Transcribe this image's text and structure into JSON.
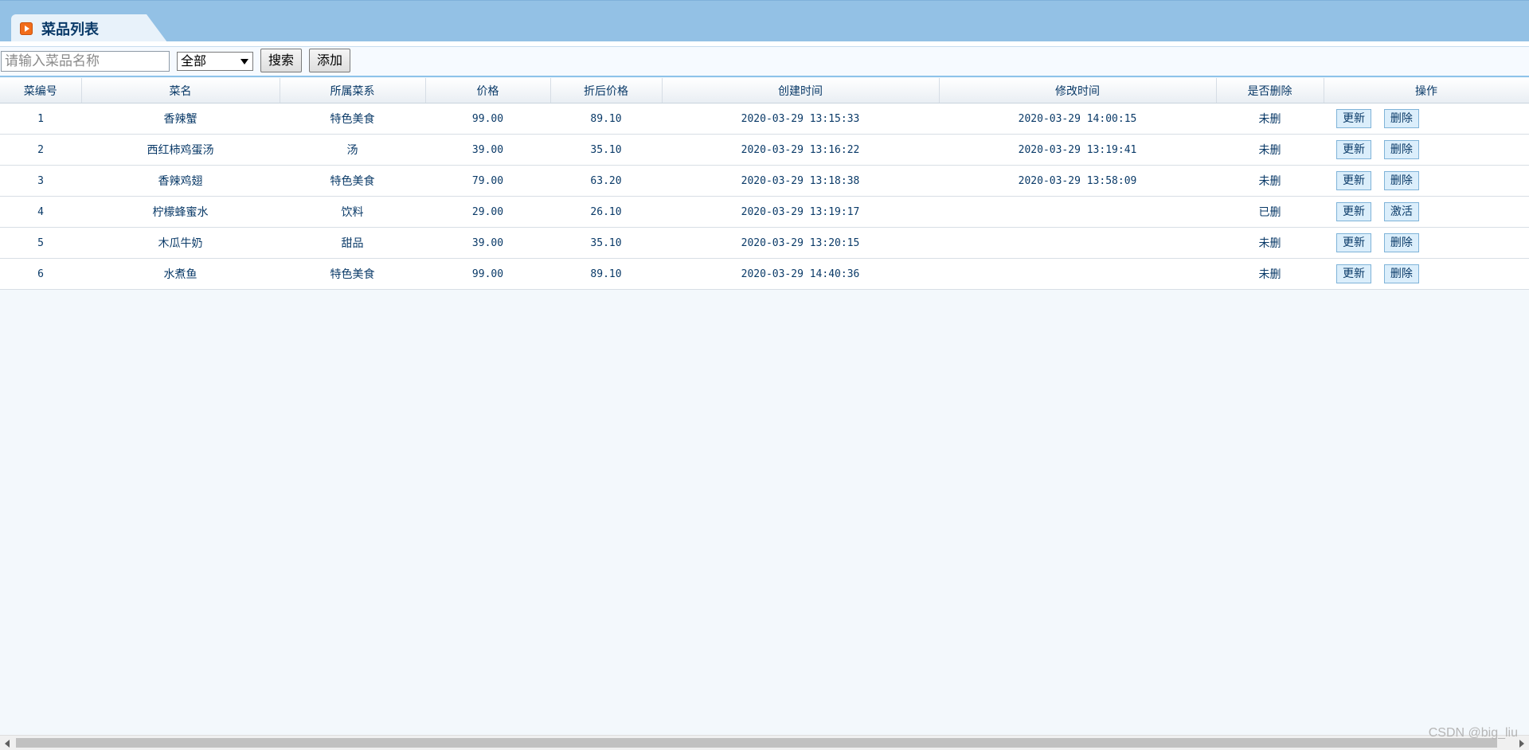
{
  "header": {
    "title": "菜品列表",
    "icon": "play-icon"
  },
  "toolbar": {
    "search_placeholder": "请输入菜品名称",
    "search_value": "",
    "category_selected": "全部",
    "search_label": "搜索",
    "add_label": "添加"
  },
  "table": {
    "columns": [
      "菜编号",
      "菜名",
      "所属菜系",
      "价格",
      "折后价格",
      "创建时间",
      "修改时间",
      "是否删除",
      "操作"
    ],
    "rows": [
      {
        "id": "1",
        "name": "香辣蟹",
        "category": "特色美食",
        "price": "99.00",
        "discount": "89.10",
        "created": "2020-03-29 13:15:33",
        "modified": "2020-03-29 14:00:15",
        "deleted": "未删",
        "update_label": "更新",
        "action_label": "删除"
      },
      {
        "id": "2",
        "name": "西红柿鸡蛋汤",
        "category": "汤",
        "price": "39.00",
        "discount": "35.10",
        "created": "2020-03-29 13:16:22",
        "modified": "2020-03-29 13:19:41",
        "deleted": "未删",
        "update_label": "更新",
        "action_label": "删除"
      },
      {
        "id": "3",
        "name": "香辣鸡翅",
        "category": "特色美食",
        "price": "79.00",
        "discount": "63.20",
        "created": "2020-03-29 13:18:38",
        "modified": "2020-03-29 13:58:09",
        "deleted": "未删",
        "update_label": "更新",
        "action_label": "删除"
      },
      {
        "id": "4",
        "name": "柠檬蜂蜜水",
        "category": "饮料",
        "price": "29.00",
        "discount": "26.10",
        "created": "2020-03-29 13:19:17",
        "modified": "",
        "deleted": "已删",
        "update_label": "更新",
        "action_label": "激活"
      },
      {
        "id": "5",
        "name": "木瓜牛奶",
        "category": "甜品",
        "price": "39.00",
        "discount": "35.10",
        "created": "2020-03-29 13:20:15",
        "modified": "",
        "deleted": "未删",
        "update_label": "更新",
        "action_label": "删除"
      },
      {
        "id": "6",
        "name": "水煮鱼",
        "category": "特色美食",
        "price": "99.00",
        "discount": "89.10",
        "created": "2020-03-29 14:40:36",
        "modified": "",
        "deleted": "未删",
        "update_label": "更新",
        "action_label": "删除"
      }
    ]
  },
  "watermark": "CSDN @big_liu",
  "colors": {
    "header_bg": "#93c1e5",
    "title_text": "#0a3a68",
    "icon_orange": "#f26d1a",
    "op_button_bg": "#dbeefb",
    "page_bg": "#f3f8fc"
  }
}
